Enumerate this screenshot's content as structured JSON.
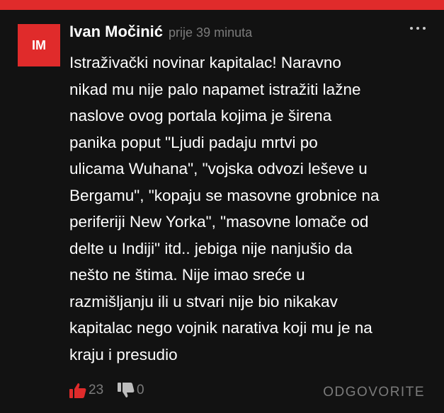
{
  "avatar": {
    "initials": "IM"
  },
  "comment": {
    "author": "Ivan Močinić",
    "time": "prije 39 minuta",
    "lines": [
      "Istraživački novinar kapitalac! Naravno",
      "nikad mu nije palo napamet istražiti lažne",
      "naslove ovog portala kojima je širena",
      "panika poput \"Ljudi padaju mrtvi po",
      "ulicama Wuhana\", \"vojska odvozi leševe u",
      "Bergamu\", \"kopaju se masovne grobnice na",
      "periferiji New Yorka\", \"masovne lomače od",
      "delte u Indiji\" itd.. jebiga nije nanjušio da",
      "nešto ne štima. Nije imao sreće u",
      "razmišljanju ili u stvari nije bio nikakav",
      "kapitalac nego vojnik narativa koji mu je na",
      "kraju i presudio"
    ],
    "upvotes": "23",
    "downvotes": "0",
    "reply_label": "ODGOVORITE"
  },
  "icons": {
    "more": "more-options-icon",
    "upvote": "thumbs-up-icon",
    "downvote": "thumbs-down-icon"
  },
  "colors": {
    "accent": "#e02b2b",
    "background": "#121212",
    "muted_text": "#7b7b7b",
    "text": "#ffffff"
  }
}
